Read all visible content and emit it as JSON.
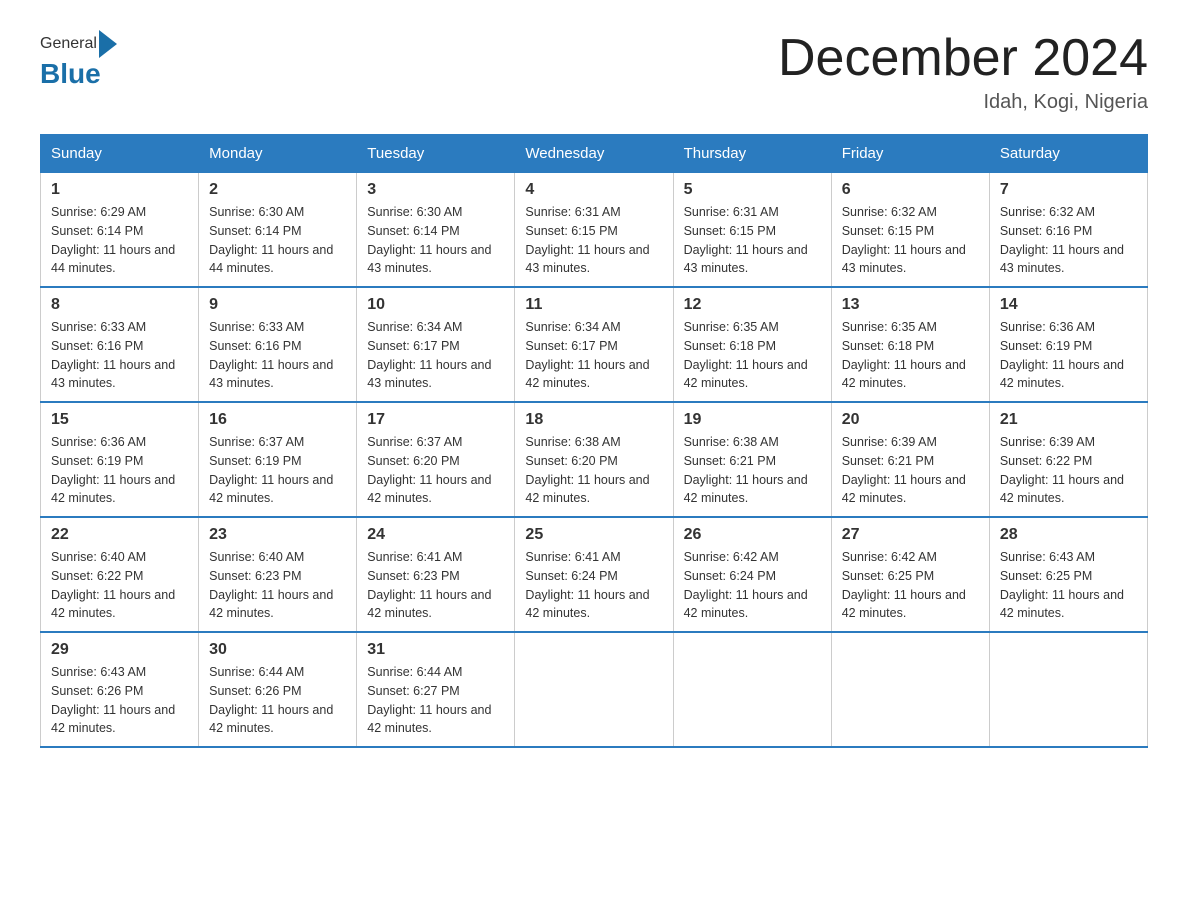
{
  "header": {
    "logo_general": "General",
    "logo_blue": "Blue",
    "month_title": "December 2024",
    "location": "Idah, Kogi, Nigeria"
  },
  "weekdays": [
    "Sunday",
    "Monday",
    "Tuesday",
    "Wednesday",
    "Thursday",
    "Friday",
    "Saturday"
  ],
  "weeks": [
    [
      {
        "day": "1",
        "sunrise": "6:29 AM",
        "sunset": "6:14 PM",
        "daylight": "11 hours and 44 minutes."
      },
      {
        "day": "2",
        "sunrise": "6:30 AM",
        "sunset": "6:14 PM",
        "daylight": "11 hours and 44 minutes."
      },
      {
        "day": "3",
        "sunrise": "6:30 AM",
        "sunset": "6:14 PM",
        "daylight": "11 hours and 43 minutes."
      },
      {
        "day": "4",
        "sunrise": "6:31 AM",
        "sunset": "6:15 PM",
        "daylight": "11 hours and 43 minutes."
      },
      {
        "day": "5",
        "sunrise": "6:31 AM",
        "sunset": "6:15 PM",
        "daylight": "11 hours and 43 minutes."
      },
      {
        "day": "6",
        "sunrise": "6:32 AM",
        "sunset": "6:15 PM",
        "daylight": "11 hours and 43 minutes."
      },
      {
        "day": "7",
        "sunrise": "6:32 AM",
        "sunset": "6:16 PM",
        "daylight": "11 hours and 43 minutes."
      }
    ],
    [
      {
        "day": "8",
        "sunrise": "6:33 AM",
        "sunset": "6:16 PM",
        "daylight": "11 hours and 43 minutes."
      },
      {
        "day": "9",
        "sunrise": "6:33 AM",
        "sunset": "6:16 PM",
        "daylight": "11 hours and 43 minutes."
      },
      {
        "day": "10",
        "sunrise": "6:34 AM",
        "sunset": "6:17 PM",
        "daylight": "11 hours and 43 minutes."
      },
      {
        "day": "11",
        "sunrise": "6:34 AM",
        "sunset": "6:17 PM",
        "daylight": "11 hours and 42 minutes."
      },
      {
        "day": "12",
        "sunrise": "6:35 AM",
        "sunset": "6:18 PM",
        "daylight": "11 hours and 42 minutes."
      },
      {
        "day": "13",
        "sunrise": "6:35 AM",
        "sunset": "6:18 PM",
        "daylight": "11 hours and 42 minutes."
      },
      {
        "day": "14",
        "sunrise": "6:36 AM",
        "sunset": "6:19 PM",
        "daylight": "11 hours and 42 minutes."
      }
    ],
    [
      {
        "day": "15",
        "sunrise": "6:36 AM",
        "sunset": "6:19 PM",
        "daylight": "11 hours and 42 minutes."
      },
      {
        "day": "16",
        "sunrise": "6:37 AM",
        "sunset": "6:19 PM",
        "daylight": "11 hours and 42 minutes."
      },
      {
        "day": "17",
        "sunrise": "6:37 AM",
        "sunset": "6:20 PM",
        "daylight": "11 hours and 42 minutes."
      },
      {
        "day": "18",
        "sunrise": "6:38 AM",
        "sunset": "6:20 PM",
        "daylight": "11 hours and 42 minutes."
      },
      {
        "day": "19",
        "sunrise": "6:38 AM",
        "sunset": "6:21 PM",
        "daylight": "11 hours and 42 minutes."
      },
      {
        "day": "20",
        "sunrise": "6:39 AM",
        "sunset": "6:21 PM",
        "daylight": "11 hours and 42 minutes."
      },
      {
        "day": "21",
        "sunrise": "6:39 AM",
        "sunset": "6:22 PM",
        "daylight": "11 hours and 42 minutes."
      }
    ],
    [
      {
        "day": "22",
        "sunrise": "6:40 AM",
        "sunset": "6:22 PM",
        "daylight": "11 hours and 42 minutes."
      },
      {
        "day": "23",
        "sunrise": "6:40 AM",
        "sunset": "6:23 PM",
        "daylight": "11 hours and 42 minutes."
      },
      {
        "day": "24",
        "sunrise": "6:41 AM",
        "sunset": "6:23 PM",
        "daylight": "11 hours and 42 minutes."
      },
      {
        "day": "25",
        "sunrise": "6:41 AM",
        "sunset": "6:24 PM",
        "daylight": "11 hours and 42 minutes."
      },
      {
        "day": "26",
        "sunrise": "6:42 AM",
        "sunset": "6:24 PM",
        "daylight": "11 hours and 42 minutes."
      },
      {
        "day": "27",
        "sunrise": "6:42 AM",
        "sunset": "6:25 PM",
        "daylight": "11 hours and 42 minutes."
      },
      {
        "day": "28",
        "sunrise": "6:43 AM",
        "sunset": "6:25 PM",
        "daylight": "11 hours and 42 minutes."
      }
    ],
    [
      {
        "day": "29",
        "sunrise": "6:43 AM",
        "sunset": "6:26 PM",
        "daylight": "11 hours and 42 minutes."
      },
      {
        "day": "30",
        "sunrise": "6:44 AM",
        "sunset": "6:26 PM",
        "daylight": "11 hours and 42 minutes."
      },
      {
        "day": "31",
        "sunrise": "6:44 AM",
        "sunset": "6:27 PM",
        "daylight": "11 hours and 42 minutes."
      },
      null,
      null,
      null,
      null
    ]
  ]
}
